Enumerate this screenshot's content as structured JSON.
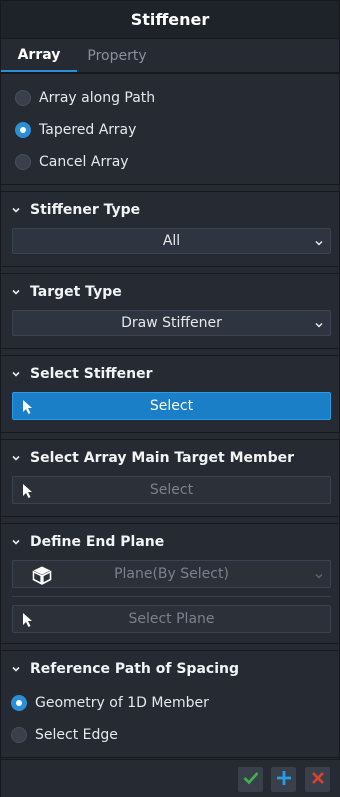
{
  "window": {
    "title": "Stiffener"
  },
  "tabs": [
    {
      "label": "Array",
      "active": true
    },
    {
      "label": "Property",
      "active": false
    }
  ],
  "array_mode": {
    "options": [
      {
        "label": "Array along Path",
        "selected": false
      },
      {
        "label": "Tapered Array",
        "selected": true
      },
      {
        "label": "Cancel Array",
        "selected": false
      }
    ]
  },
  "stiffener_type": {
    "header": "Stiffener Type",
    "value": "All"
  },
  "target_type": {
    "header": "Target Type",
    "value": "Draw Stiffener"
  },
  "select_stiffener": {
    "header": "Select Stiffener",
    "button": "Select"
  },
  "select_array_main": {
    "header": "Select Array Main Target Member",
    "button": "Select"
  },
  "define_end_plane": {
    "header": "Define End Plane",
    "value": "Plane(By Select)",
    "button": "Select Plane"
  },
  "reference_path": {
    "header": "Reference Path of Spacing",
    "options": [
      {
        "label": "Geometry of 1D Member",
        "selected": true
      },
      {
        "label": "Select Edge",
        "selected": false
      }
    ]
  },
  "colors": {
    "accent": "#1a7fc6",
    "ok": "#3fb34f",
    "add": "#2a9be6",
    "cancel": "#e0402e"
  },
  "icons": {
    "ok": "check-icon",
    "add": "plus-icon",
    "cancel": "close-icon"
  }
}
